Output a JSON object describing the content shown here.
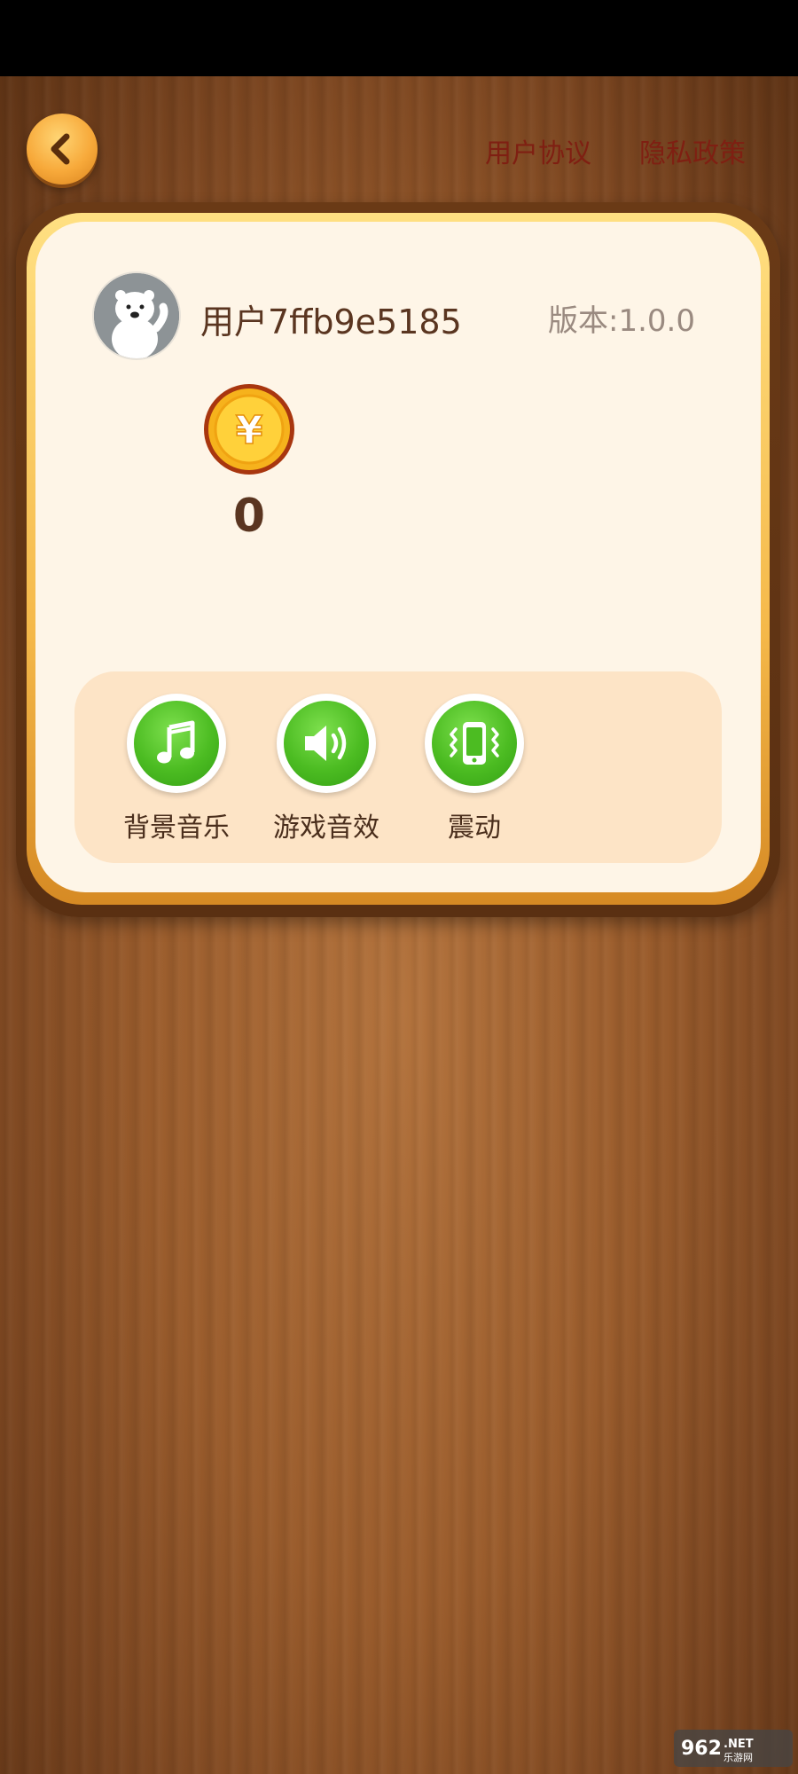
{
  "header": {
    "back_icon": "chevron-left-icon",
    "user_agreement": "用户协议",
    "privacy_policy": "隐私政策"
  },
  "profile": {
    "avatar_icon": "polar-bear-avatar",
    "username": "用户7ffb9e5185",
    "version": "版本:1.0.0"
  },
  "coins": {
    "icon": "yuan-coin-icon",
    "count": "0"
  },
  "settings": [
    {
      "label": "背景音乐",
      "icon": "music-note-icon"
    },
    {
      "label": "游戏音效",
      "icon": "speaker-icon"
    },
    {
      "label": "震动",
      "icon": "vibrate-phone-icon"
    }
  ],
  "watermark": {
    "text": "962.NET 乐游网"
  },
  "colors": {
    "wood": "#9a5c2c",
    "card": "#fef5e7",
    "accent_green": "#4cbc22",
    "link_red": "#7f1f12",
    "text_brown": "#5a3520"
  }
}
